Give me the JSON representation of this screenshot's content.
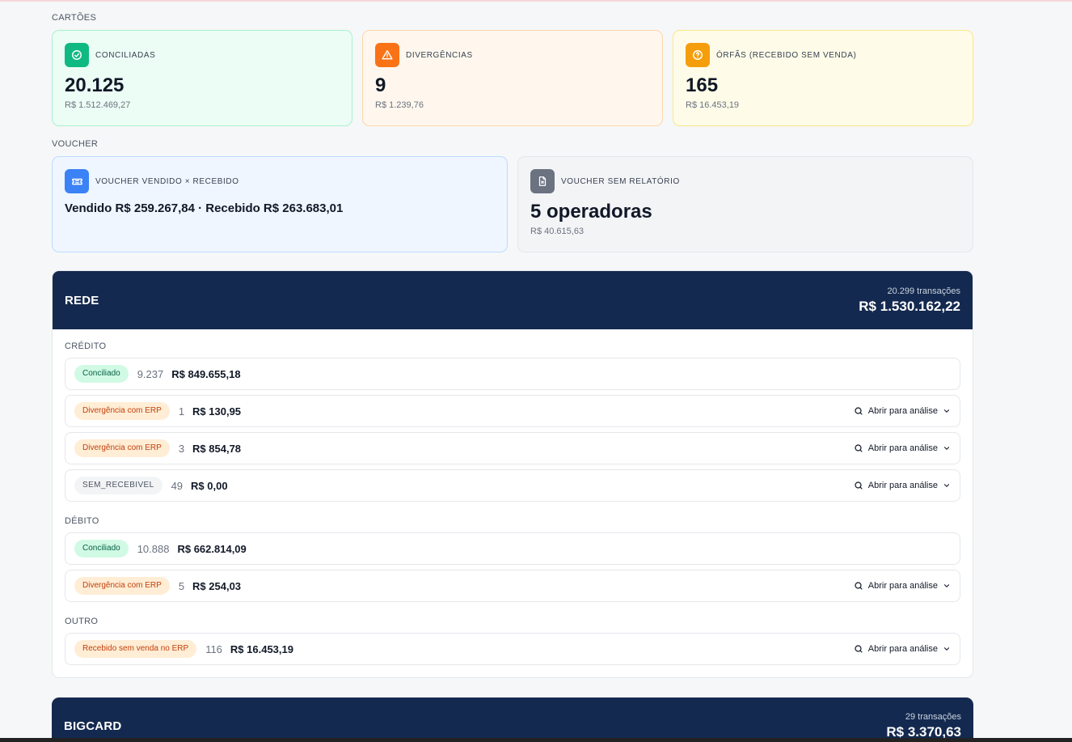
{
  "sections": {
    "cartoes_label": "CARTÕES",
    "voucher_label": "VOUCHER"
  },
  "cards": [
    {
      "title": "CONCILIADAS",
      "value": "20.125",
      "amount": "R$ 1.512.469,27",
      "icon": "check-circle-icon"
    },
    {
      "title": "DIVERGÊNCIAS",
      "value": "9",
      "amount": "R$ 1.239,76",
      "icon": "alert-triangle-icon"
    },
    {
      "title": "ÓRFÃS (RECEBIDO SEM VENDA)",
      "value": "165",
      "amount": "R$ 16.453,19",
      "icon": "question-circle-icon"
    }
  ],
  "voucher_cards": [
    {
      "title": "VOUCHER VENDIDO × RECEBIDO",
      "line": "Vendido R$ 259.267,84 · Recebido R$ 263.683,01",
      "icon": "ticket-icon"
    },
    {
      "title": "VOUCHER SEM RELATÓRIO",
      "value": "5 operadoras",
      "amount": "R$ 40.615,63",
      "icon": "file-x-icon"
    }
  ],
  "panels": [
    {
      "name": "REDE",
      "transactions": "20.299 transações",
      "total": "R$ 1.530.162,22",
      "groups": [
        {
          "label": "CRÉDITO",
          "rows": [
            {
              "status": "Conciliado",
              "count": "9.237",
              "amount": "R$ 849.655,18",
              "action": ""
            },
            {
              "status": "Divergência com ERP",
              "count": "1",
              "amount": "R$ 130,95",
              "action": "Abrir para análise"
            },
            {
              "status": "Divergência com ERP",
              "count": "3",
              "amount": "R$ 854,78",
              "action": "Abrir para análise"
            },
            {
              "status": "SEM_RECEBIVEL",
              "count": "49",
              "amount": "R$ 0,00",
              "action": "Abrir para análise"
            }
          ]
        },
        {
          "label": "DÉBITO",
          "rows": [
            {
              "status": "Conciliado",
              "count": "10.888",
              "amount": "R$ 662.814,09",
              "action": ""
            },
            {
              "status": "Divergência com ERP",
              "count": "5",
              "amount": "R$ 254,03",
              "action": "Abrir para análise"
            }
          ]
        },
        {
          "label": "OUTRO",
          "rows": [
            {
              "status": "Recebido sem venda no ERP",
              "count": "116",
              "amount": "R$ 16.453,19",
              "action": "Abrir para análise"
            }
          ]
        }
      ]
    },
    {
      "name": "BIGCARD",
      "transactions": "29 transações",
      "total": "R$ 3.370,63"
    }
  ],
  "colors": {
    "panel_header": "#14294f",
    "conciliado": "#10b981",
    "divergencia": "#f97316",
    "orfas": "#f59e0b",
    "voucher": "#3b82f6"
  }
}
